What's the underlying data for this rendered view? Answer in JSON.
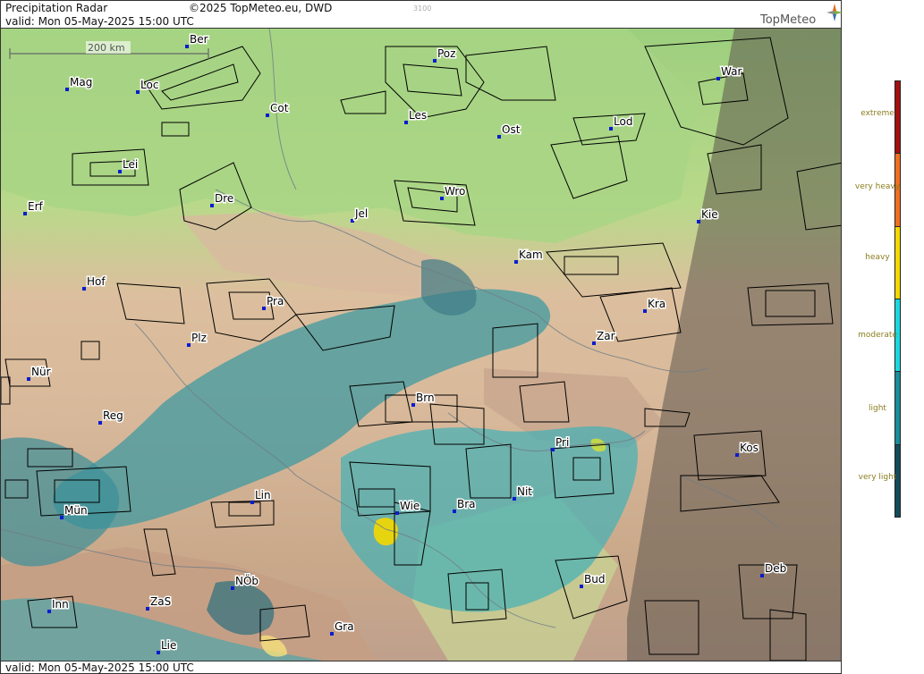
{
  "header": {
    "title": "Precipitation Radar",
    "copyright": "©2025 TopMeteo.eu, DWD",
    "image_id_text": "3100",
    "valid": "valid:  Mon  05-May-2025 15:00 UTC"
  },
  "logo": {
    "text": "TopMeteo",
    "icon": "compass-star-icon"
  },
  "footer": {
    "valid": "valid:  Mon  05-May-2025 15:00 UTC"
  },
  "scale": {
    "label": "200 km"
  },
  "legend": {
    "levels": [
      {
        "label": "extreme",
        "color": "#a31010"
      },
      {
        "label": "very heavy",
        "color": "#f07020"
      },
      {
        "label": "heavy",
        "color": "#f5d800"
      },
      {
        "label": "moderate",
        "color": "#19d8de"
      },
      {
        "label": "light",
        "color": "#1a8c9a"
      },
      {
        "label": "very light",
        "color": "#144a5c"
      }
    ]
  },
  "cities": [
    {
      "name": "Ber"
    },
    {
      "name": "Poz"
    },
    {
      "name": "Mag"
    },
    {
      "name": "Loc"
    },
    {
      "name": "Cot"
    },
    {
      "name": "Les"
    },
    {
      "name": "Ost"
    },
    {
      "name": "Lod"
    },
    {
      "name": "War"
    },
    {
      "name": "Lei"
    },
    {
      "name": "Dre"
    },
    {
      "name": "Wro"
    },
    {
      "name": "Erf"
    },
    {
      "name": "Jel"
    },
    {
      "name": "Kie"
    },
    {
      "name": "Kam"
    },
    {
      "name": "Hof"
    },
    {
      "name": "Pra"
    },
    {
      "name": "Kra"
    },
    {
      "name": "Plz"
    },
    {
      "name": "Zar"
    },
    {
      "name": "Nür"
    },
    {
      "name": "Brn"
    },
    {
      "name": "Reg"
    },
    {
      "name": "Pri"
    },
    {
      "name": "Kos"
    },
    {
      "name": "Nit"
    },
    {
      "name": "Lin"
    },
    {
      "name": "Wie"
    },
    {
      "name": "Bra"
    },
    {
      "name": "Mün"
    },
    {
      "name": "Deb"
    },
    {
      "name": "Bud"
    },
    {
      "name": "NÖb"
    },
    {
      "name": "Inn"
    },
    {
      "name": "ZaS"
    },
    {
      "name": "Gra"
    },
    {
      "name": "Lie"
    }
  ]
}
